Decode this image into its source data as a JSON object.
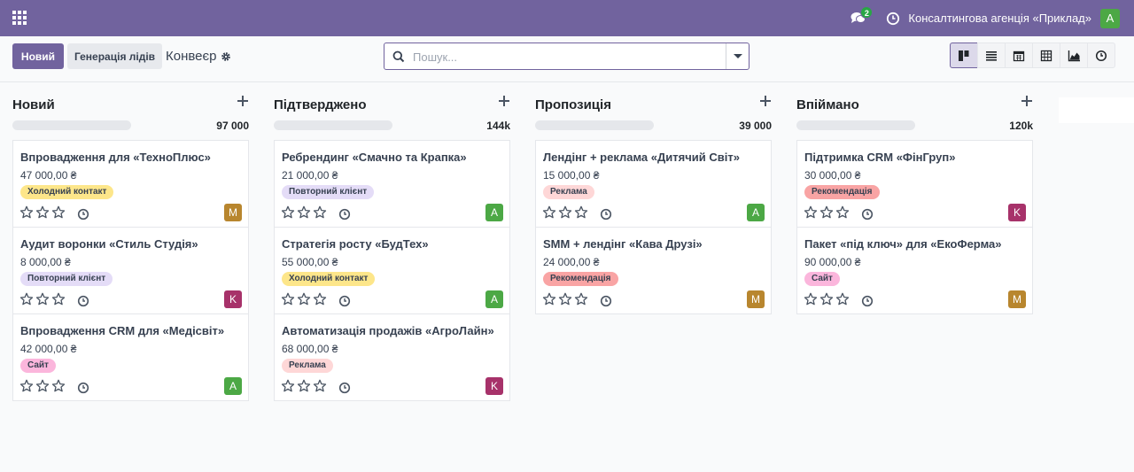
{
  "navbar": {
    "chat_count": "2",
    "company": "Консалтингова агенція «Приклад»",
    "user_initial": "A",
    "user_color": "#4ca845",
    "bg_color": "#71639e"
  },
  "control": {
    "new_label": "Новий",
    "generate_label": "Генерація лідів",
    "breadcrumb": "Конвеєр",
    "search_placeholder": "Пошук..."
  },
  "views": [
    "kanban-view-icon",
    "list-view-icon",
    "calendar-view-icon",
    "pivot-view-icon",
    "graph-view-icon",
    "activity-view-icon"
  ],
  "columns": [
    {
      "title": "Новий",
      "total": "97 000",
      "cards": [
        {
          "title": "Впровадження для «ТехноПлюс»",
          "amount": "47 000,00 ₴",
          "tag": "Холодний контакт",
          "tag_color": "#fde68a",
          "avatar": "M",
          "avatar_color": "#b8862e"
        },
        {
          "title": "Аудит воронки «Стиль Студія»",
          "amount": "8 000,00 ₴",
          "tag": "Повторний клієнт",
          "tag_color": "#e4dcf7",
          "avatar": "K",
          "avatar_color": "#a7326a"
        },
        {
          "title": "Впровадження CRM для «Медісвіт»",
          "amount": "42 000,00 ₴",
          "tag": "Сайт",
          "tag_color": "#fbb6dc",
          "avatar": "A",
          "avatar_color": "#4ca845"
        }
      ]
    },
    {
      "title": "Підтверджено",
      "total": "144k",
      "cards": [
        {
          "title": "Ребрендинг «Смачно та Крапка»",
          "amount": "21 000,00 ₴",
          "tag": "Повторний клієнт",
          "tag_color": "#e4dcf7",
          "avatar": "A",
          "avatar_color": "#4ca845"
        },
        {
          "title": "Стратегія росту «БудТех»",
          "amount": "55 000,00 ₴",
          "tag": "Холодний контакт",
          "tag_color": "#fde68a",
          "avatar": "A",
          "avatar_color": "#4ca845"
        },
        {
          "title": "Автоматизація продажів «АгроЛайн»",
          "amount": "68 000,00 ₴",
          "tag": "Реклама",
          "tag_color": "#fed7d7",
          "avatar": "K",
          "avatar_color": "#a7326a"
        }
      ]
    },
    {
      "title": "Пропозиція",
      "total": "39 000",
      "cards": [
        {
          "title": "Лендінг + реклама «Дитячий Світ»",
          "amount": "15 000,00 ₴",
          "tag": "Реклама",
          "tag_color": "#fed7d7",
          "avatar": "A",
          "avatar_color": "#4ca845"
        },
        {
          "title": "SMM + лендінг «Кава Друзі»",
          "amount": "24 000,00 ₴",
          "tag": "Рекомендація",
          "tag_color": "#f9a4a4",
          "avatar": "M",
          "avatar_color": "#b8862e"
        }
      ]
    },
    {
      "title": "Впіймано",
      "total": "120k",
      "cards": [
        {
          "title": "Підтримка CRM «ФінГруп»",
          "amount": "30 000,00 ₴",
          "tag": "Рекомендація",
          "tag_color": "#f9a4a4",
          "avatar": "K",
          "avatar_color": "#a7326a"
        },
        {
          "title": "Пакет «під ключ» для «ЕкоФерма»",
          "amount": "90 000,00 ₴",
          "tag": "Сайт",
          "tag_color": "#fbb6dc",
          "avatar": "M",
          "avatar_color": "#b8862e"
        }
      ]
    }
  ]
}
